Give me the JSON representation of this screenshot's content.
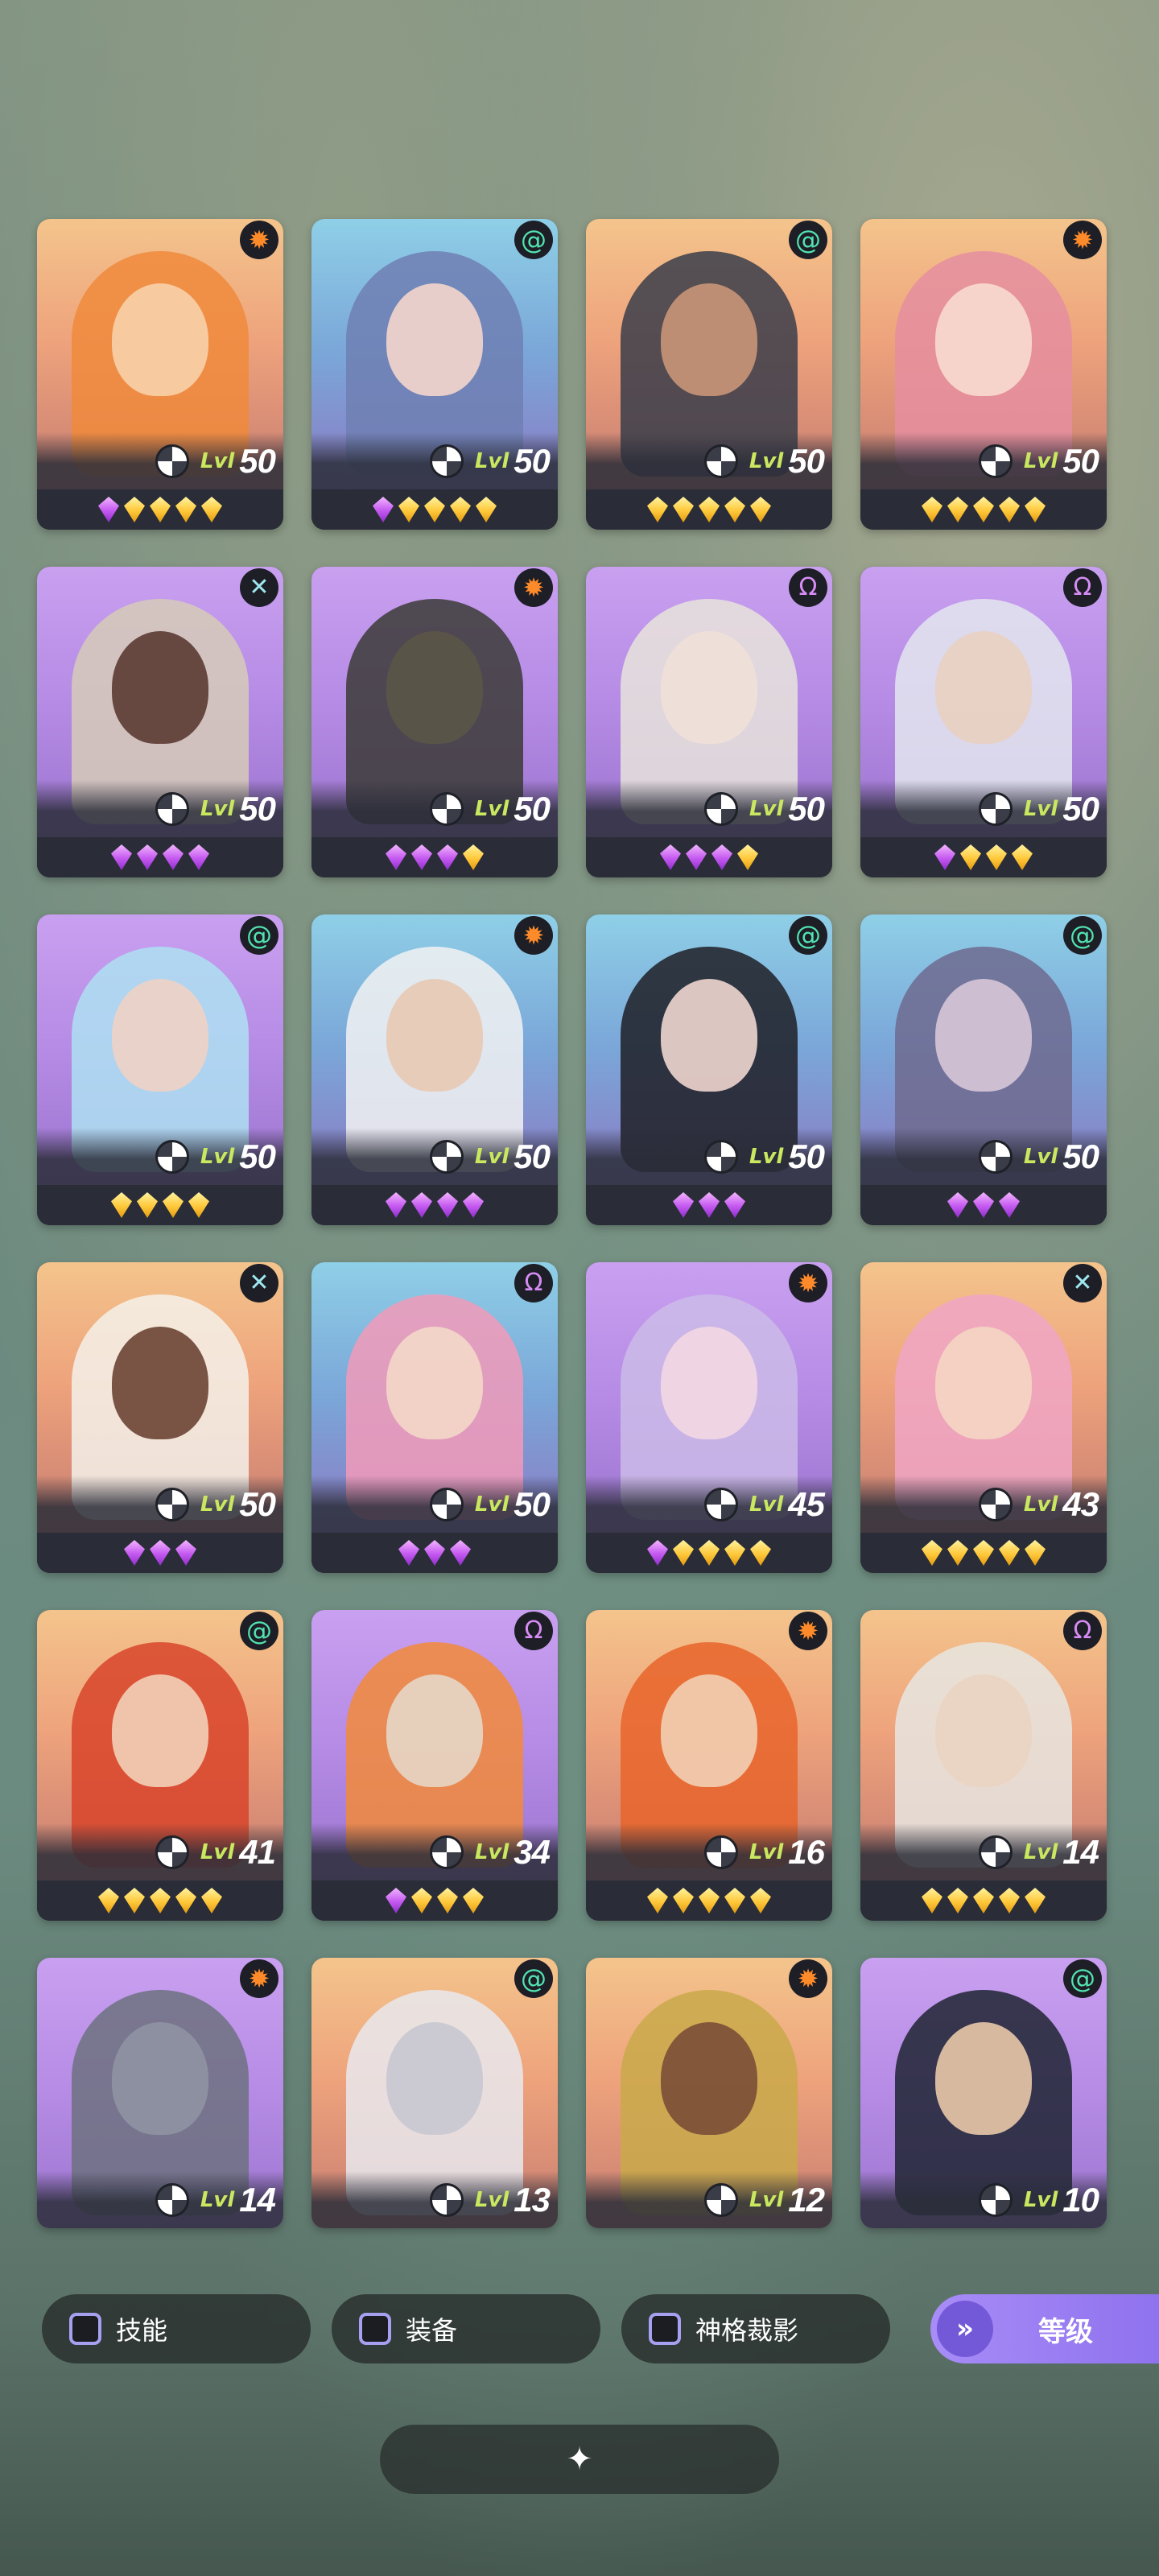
{
  "heroes": [
    {
      "faction": "sun",
      "bg": "orange",
      "tone": "#f08a3c",
      "skin": "#f7d2a8",
      "level": "50",
      "gems": [
        "purple",
        "gold",
        "gold",
        "gold",
        "gold"
      ]
    },
    {
      "faction": "spiral",
      "bg": "blue",
      "tone": "#6e7fb3",
      "skin": "#f5d6cc",
      "level": "50",
      "gems": [
        "purple",
        "gold",
        "gold",
        "gold",
        "gold"
      ]
    },
    {
      "faction": "spiral",
      "bg": "orange",
      "tone": "#3a3d4a",
      "skin": "#c99678",
      "level": "50",
      "gems": [
        "gold",
        "gold",
        "gold",
        "gold",
        "gold"
      ]
    },
    {
      "faction": "sun",
      "bg": "orange",
      "tone": "#e58ea0",
      "skin": "#f8dcd0",
      "level": "50",
      "gems": [
        "gold",
        "gold",
        "gold",
        "gold",
        "gold"
      ]
    },
    {
      "faction": "cross",
      "bg": "purple",
      "tone": "#d6cbb8",
      "skin": "#5a3b33",
      "level": "50",
      "gems": [
        "purple",
        "purple",
        "purple",
        "purple"
      ]
    },
    {
      "faction": "sun",
      "bg": "purple",
      "tone": "#3b3b37",
      "skin": "#5b5547",
      "level": "50",
      "gems": [
        "purple",
        "purple",
        "purple",
        "gold"
      ]
    },
    {
      "faction": "omega",
      "bg": "purple",
      "tone": "#e8e4dc",
      "skin": "#f1e0d8",
      "level": "50",
      "gems": [
        "purple",
        "purple",
        "purple",
        "gold"
      ]
    },
    {
      "faction": "omega",
      "bg": "purple",
      "tone": "#e3e6ee",
      "skin": "#e8d0c0",
      "level": "50",
      "gems": [
        "purple",
        "gold",
        "gold",
        "gold"
      ]
    },
    {
      "faction": "spiral",
      "bg": "purple",
      "tone": "#aee0f2",
      "skin": "#f0d2c4",
      "level": "50",
      "gems": [
        "gold",
        "gold",
        "gold",
        "gold"
      ]
    },
    {
      "faction": "sun",
      "bg": "blue",
      "tone": "#f2f2f2",
      "skin": "#e9c9b4",
      "level": "50",
      "gems": [
        "purple",
        "purple",
        "purple",
        "purple"
      ]
    },
    {
      "faction": "spiral",
      "bg": "blue",
      "tone": "#1e1f26",
      "skin": "#f0d6cf",
      "level": "50",
      "gems": [
        "purple",
        "purple",
        "purple"
      ]
    },
    {
      "faction": "spiral",
      "bg": "blue",
      "tone": "#6f6a8f",
      "skin": "#d8c6d8",
      "level": "50",
      "gems": [
        "purple",
        "purple",
        "purple"
      ]
    },
    {
      "faction": "cross",
      "bg": "orange",
      "tone": "#f4f1ea",
      "skin": "#6b4434",
      "level": "50",
      "gems": [
        "purple",
        "purple",
        "purple"
      ]
    },
    {
      "faction": "omega",
      "bg": "blue",
      "tone": "#f29ab9",
      "skin": "#f4d8c8",
      "level": "50",
      "gems": [
        "purple",
        "purple",
        "purple"
      ]
    },
    {
      "faction": "sun",
      "bg": "purple",
      "tone": "#cbbbe8",
      "skin": "#f3d7e3",
      "level": "45",
      "gems": [
        "purple",
        "gold",
        "gold",
        "gold",
        "gold"
      ]
    },
    {
      "faction": "cross",
      "bg": "orange",
      "tone": "#f0a6c6",
      "skin": "#f4d6c4",
      "level": "43",
      "gems": [
        "gold",
        "gold",
        "gold",
        "gold",
        "gold"
      ]
    },
    {
      "faction": "spiral",
      "bg": "orange",
      "tone": "#d8442a",
      "skin": "#f2d0b8",
      "level": "41",
      "gems": [
        "gold",
        "gold",
        "gold",
        "gold",
        "gold"
      ]
    },
    {
      "faction": "omega",
      "bg": "purple",
      "tone": "#f28a3a",
      "skin": "#e6d6c6",
      "level": "34",
      "gems": [
        "purple",
        "gold",
        "gold",
        "gold"
      ]
    },
    {
      "faction": "sun",
      "bg": "orange",
      "tone": "#e8642a",
      "skin": "#f2cfb4",
      "level": "16",
      "gems": [
        "gold",
        "gold",
        "gold",
        "gold",
        "gold"
      ]
    },
    {
      "faction": "omega",
      "bg": "orange",
      "tone": "#e8e6e2",
      "skin": "#ead4c2",
      "level": "14",
      "gems": [
        "gold",
        "gold",
        "gold",
        "gold",
        "gold"
      ]
    },
    {
      "faction": "sun",
      "bg": "purple",
      "tone": "#6d7180",
      "skin": "#8f94a3",
      "level": "14",
      "gems": []
    },
    {
      "faction": "spiral",
      "bg": "orange",
      "tone": "#e9e9ee",
      "skin": "#c8c8d2",
      "level": "13",
      "gems": []
    },
    {
      "faction": "sun",
      "bg": "orange",
      "tone": "#c9a94a",
      "skin": "#7a4e36",
      "level": "12",
      "gems": []
    },
    {
      "faction": "spiral",
      "bg": "purple",
      "tone": "#1f2433",
      "skin": "#e8c8a8",
      "level": "10",
      "gems": []
    }
  ],
  "level_prefix": "Lvl",
  "faction_glyphs": {
    "sun": "✹",
    "spiral": "@",
    "omega": "Ω",
    "cross": "✕"
  },
  "filters": {
    "skill": "技能",
    "equipment": "装备",
    "divine_crop": "神格裁影",
    "level": "等级",
    "level_icon": "»"
  },
  "bottom_bar_icon": "✦"
}
